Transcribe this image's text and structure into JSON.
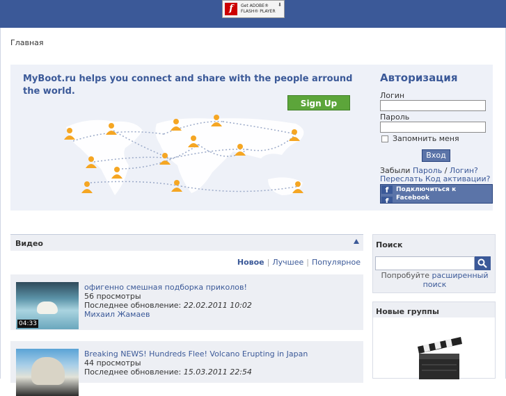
{
  "topbar": {
    "flash_badge": {
      "line1": "Get ADOBE®",
      "line2": "FLASH® PLAYER",
      "logo": "f",
      "icon": "flash-logo-icon"
    }
  },
  "breadcrumb": "Главная",
  "hero": {
    "brand": "MyBoot.ru",
    "tagline": "helps you connect and share with the people arround the world.",
    "signup_label": "Sign Up"
  },
  "auth": {
    "title": "Авторизация",
    "login_label": "Логин",
    "login_value": "",
    "password_label": "Пароль",
    "password_value": "",
    "remember_label": "Запомнить меня",
    "remember_checked": false,
    "login_button": "Вход",
    "forgot_prefix": "Забыли",
    "forgot_password": "Пароль",
    "forgot_sep": "/",
    "forgot_login": "Логин?",
    "resend_activation": "Переслать Код активации?",
    "facebook_button": "Подключиться к Facebook",
    "facebook_icon_letter": "f"
  },
  "video": {
    "title": "Видео",
    "tabs": [
      "Новое",
      "Лучшее",
      "Популярное"
    ],
    "active_tab": "Новое",
    "items": [
      {
        "title": "офигенно смешная подборка приколов!",
        "views": "56 просмотры",
        "updated_label": "Последнее обновление:",
        "updated_date": "22.02.2011 10:02",
        "author": "Михаил Жамаев",
        "duration": "04:33"
      },
      {
        "title": "Breaking NEWS! Hundreds Flee! Volcano Erupting in Japan",
        "views": "44 просмотры",
        "updated_label": "Последнее обновление:",
        "updated_date": "15.03.2011 22:54",
        "author": "",
        "duration": ""
      }
    ]
  },
  "search": {
    "title": "Поиск",
    "placeholder": "",
    "hint_prefix": "Попробуйте",
    "hint_link1": "расширенный",
    "hint_link2": "поиск"
  },
  "groups": {
    "title": "Новые группы"
  },
  "colors": {
    "brand_blue": "#3b5998",
    "signup_green": "#5ca53a",
    "panel_bg": "#edeff4"
  }
}
